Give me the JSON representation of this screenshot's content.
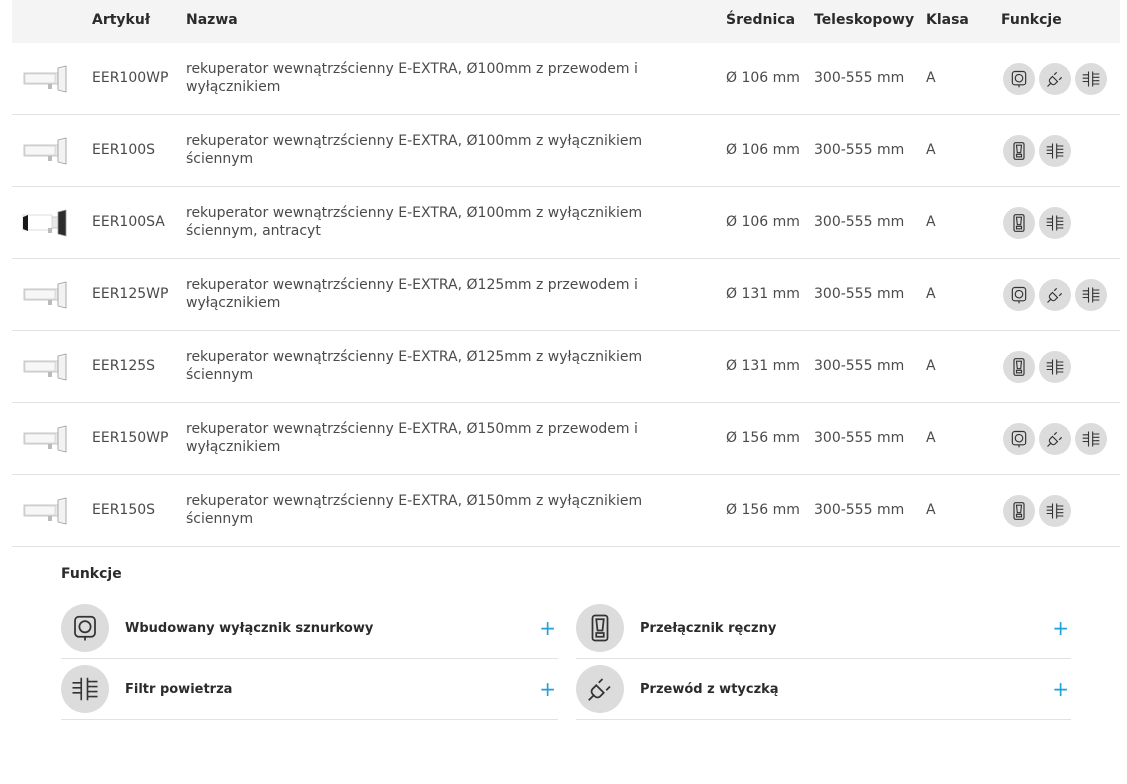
{
  "header": {
    "artykul": "Artykuł",
    "nazwa": "Nazwa",
    "srednica": "Średnica",
    "teleskopowy": "Teleskopowy",
    "klasa": "Klasa",
    "funkcje": "Funkcje"
  },
  "rows": [
    {
      "sku": "EER100WP",
      "name": "rekuperator wewnątrzścienny E-EXTRA, Ø100mm z przewodem i wyłącznikiem",
      "diameter": "Ø 106 mm",
      "telescopic": "300-555 mm",
      "class": "A",
      "icons": [
        "cord-switch",
        "plug",
        "filter"
      ],
      "color": "white"
    },
    {
      "sku": "EER100S",
      "name": "rekuperator wewnątrzścienny E-EXTRA, Ø100mm z wyłącznikiem ściennym",
      "diameter": "Ø 106 mm",
      "telescopic": "300-555 mm",
      "class": "A",
      "icons": [
        "manual-switch",
        "filter"
      ],
      "color": "white"
    },
    {
      "sku": "EER100SA",
      "name": "rekuperator wewnątrzścienny E-EXTRA, Ø100mm z wyłącznikiem ściennym, antracyt",
      "diameter": "Ø 106 mm",
      "telescopic": "300-555 mm",
      "class": "A",
      "icons": [
        "manual-switch",
        "filter"
      ],
      "color": "anthracite"
    },
    {
      "sku": "EER125WP",
      "name": "rekuperator wewnątrzścienny E-EXTRA, Ø125mm z przewodem i wyłącznikiem",
      "diameter": "Ø 131 mm",
      "telescopic": "300-555 mm",
      "class": "A",
      "icons": [
        "cord-switch",
        "plug",
        "filter"
      ],
      "color": "white"
    },
    {
      "sku": "EER125S",
      "name": "rekuperator wewnątrzścienny E-EXTRA, Ø125mm z wyłącznikiem ściennym",
      "diameter": "Ø 131 mm",
      "telescopic": "300-555 mm",
      "class": "A",
      "icons": [
        "manual-switch",
        "filter"
      ],
      "color": "white"
    },
    {
      "sku": "EER150WP",
      "name": "rekuperator wewnątrzścienny E-EXTRA, Ø150mm z przewodem i wyłącznikiem",
      "diameter": "Ø 156 mm",
      "telescopic": "300-555 mm",
      "class": "A",
      "icons": [
        "cord-switch",
        "plug",
        "filter"
      ],
      "color": "white"
    },
    {
      "sku": "EER150S",
      "name": "rekuperator wewnątrzścienny E-EXTRA, Ø150mm z wyłącznikiem ściennym",
      "diameter": "Ø 156 mm",
      "telescopic": "300-555 mm",
      "class": "A",
      "icons": [
        "manual-switch",
        "filter"
      ],
      "color": "white"
    }
  ],
  "legend": {
    "title": "Funkcje",
    "items": [
      {
        "icon": "cord-switch",
        "label": "Wbudowany wyłącznik sznurkowy"
      },
      {
        "icon": "manual-switch",
        "label": "Przełącznik ręczny"
      },
      {
        "icon": "filter",
        "label": "Filtr powietrza"
      },
      {
        "icon": "plug",
        "label": "Przewód z wtyczką"
      }
    ],
    "plus_symbol": "+"
  },
  "colors": {
    "accent": "#1fa3d6",
    "icon_bg": "#dcdcdc",
    "header_bg": "#f4f4f4"
  }
}
